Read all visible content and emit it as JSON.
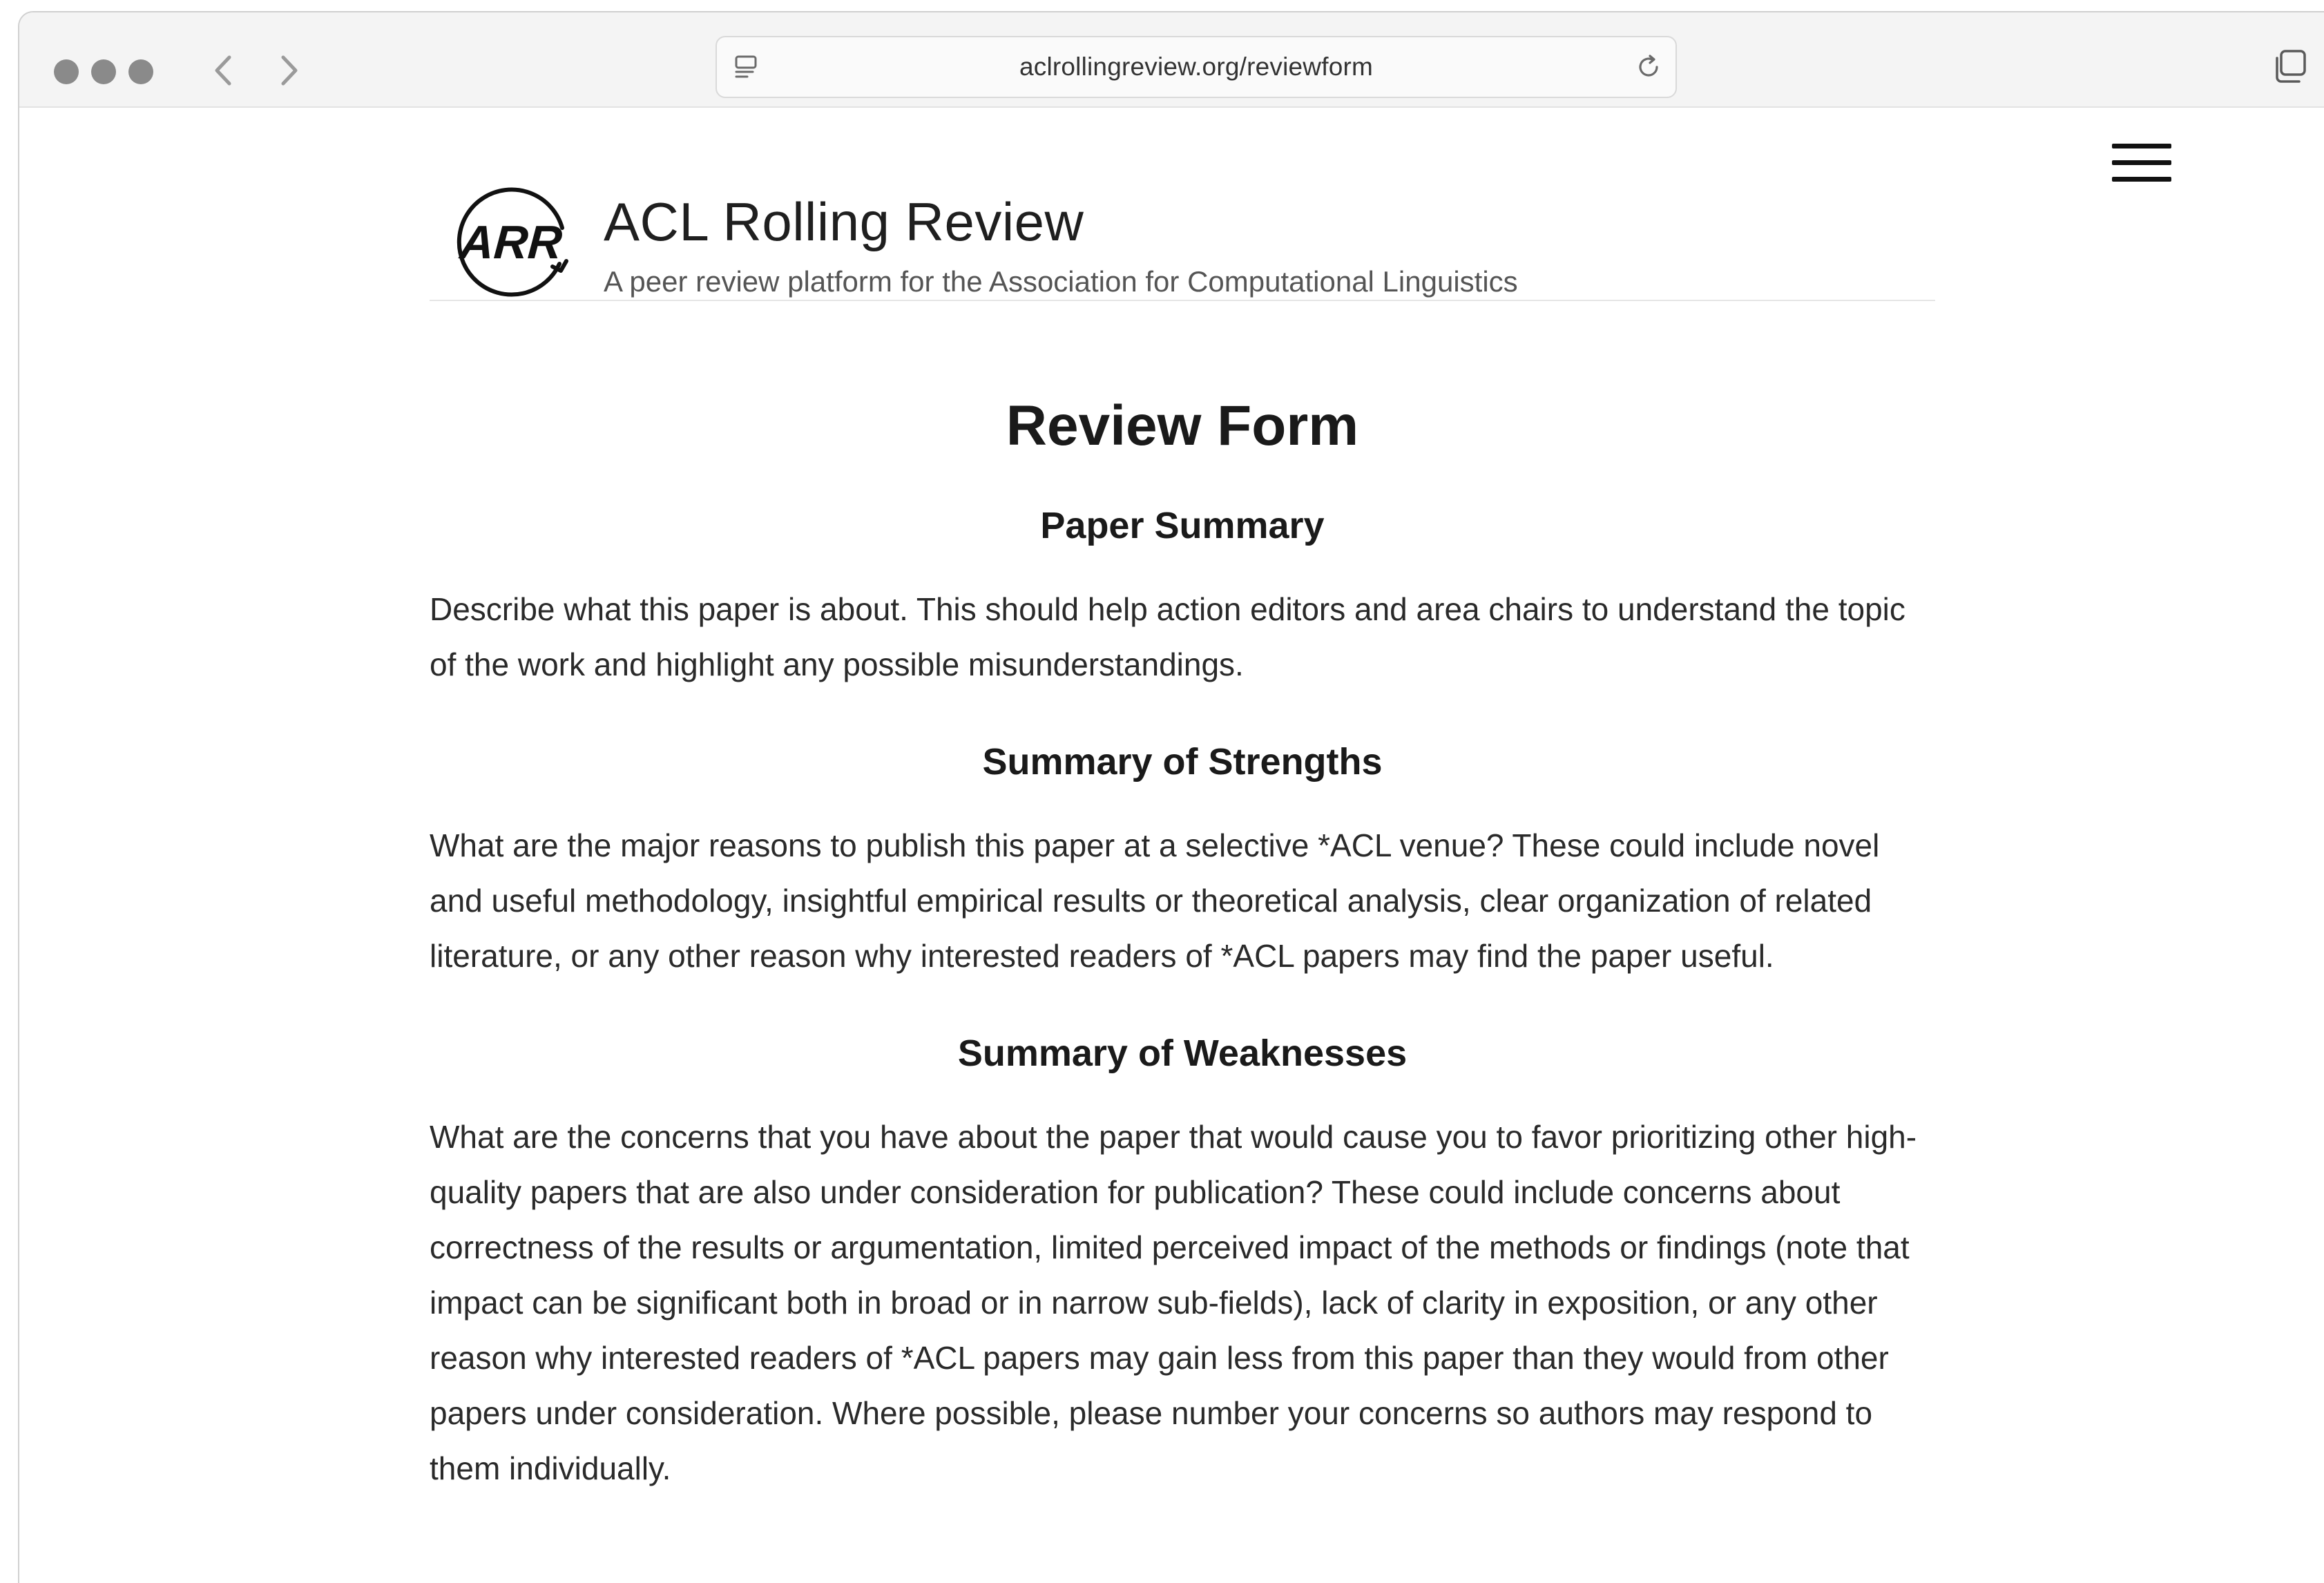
{
  "browser": {
    "url": "aclrollingreview.org/reviewform"
  },
  "site": {
    "logo_text": "ARR",
    "title": "ACL Rolling Review",
    "subtitle": "A peer review platform for the Association for Computational Linguistics"
  },
  "main": {
    "title": "Review Form",
    "sections": [
      {
        "heading": "Paper Summary",
        "text": "Describe what this paper is about. This should help action editors and area chairs to understand the topic of the work and highlight any possible misunderstandings."
      },
      {
        "heading": "Summary of Strengths",
        "text": "What are the major reasons to publish this paper at a selective *ACL venue? These could include novel and useful methodology, insightful empirical results or theoretical analysis, clear organization of related literature, or any other reason why interested readers of *ACL papers may find the paper useful."
      },
      {
        "heading": "Summary of Weaknesses",
        "text": "What are the concerns that you have about the paper that would cause you to favor prioritizing other high-quality papers that are also under consideration for publication? These could include concerns about correctness of the results or argumentation, limited perceived impact of the methods or findings (note that impact can be significant both in broad or in narrow sub-fields), lack of clarity in exposition, or any other reason why interested readers of *ACL papers may gain less from this paper than they would from other papers under consideration. Where possible, please number your concerns so authors may respond to them individually."
      }
    ]
  },
  "icons": {
    "close": "traffic-light-icon",
    "back": "chevron-left-icon",
    "forward": "chevron-right-icon",
    "site_info": "page-info-icon",
    "reload": "reload-icon",
    "tabs": "tab-overview-icon",
    "menu": "hamburger-menu-icon"
  }
}
